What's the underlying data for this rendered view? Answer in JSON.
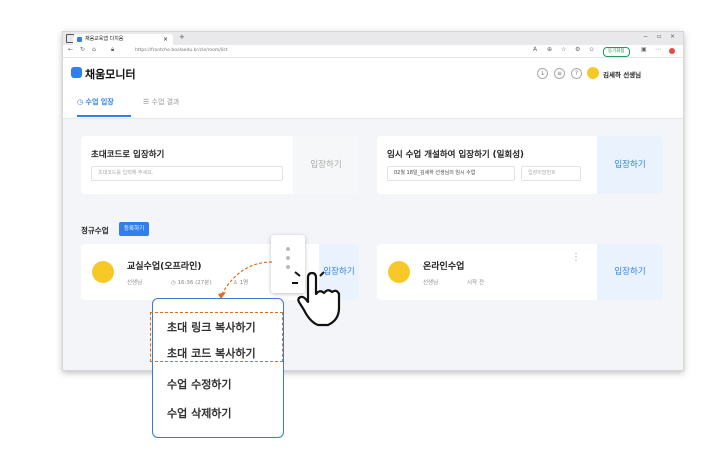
{
  "browser": {
    "tab_title": "채움교육앱 다치움",
    "url": "https://frontche.boolaedu.kr/cle/room/list",
    "profile_badge": "동기화됨"
  },
  "app": {
    "logo_text": "채움모니터",
    "user_name": "김세하 선생님",
    "user_suffix": "선생님 ∨"
  },
  "nav": {
    "tab_enter": "수업 입장",
    "tab_results": "수업 결과"
  },
  "invite_card": {
    "title": "초대코드로 입장하기",
    "placeholder": "초대코드를 입력해 주세요.",
    "button": "입장하기"
  },
  "temp_card": {
    "title": "임시 수업 개설하여 입장하기 (일회성)",
    "class_name": "02월 18일_김세하 선생님의 임시 수업",
    "password_placeholder": "입장비밀번호",
    "button": "입장하기"
  },
  "regular": {
    "title": "정규수업",
    "register_button": "등록하기"
  },
  "class_offline": {
    "name": "교실수업(오프라인)",
    "teacher": "선생님",
    "time": "16:36 (27분)",
    "people": "1명",
    "button": "입장하기"
  },
  "class_online": {
    "name": "온라인수업",
    "teacher": "선생님",
    "status": "시작 전",
    "button": "입장하기"
  },
  "context_menu": {
    "items": [
      "초대 링크 복사하기",
      "초대 코드 복사하기",
      "수업 수정하기",
      "수업 삭제하기"
    ]
  },
  "colors": {
    "accent": "#2f80ed",
    "highlight_border": "#e36b12",
    "menu_border": "#3a7bd5"
  }
}
